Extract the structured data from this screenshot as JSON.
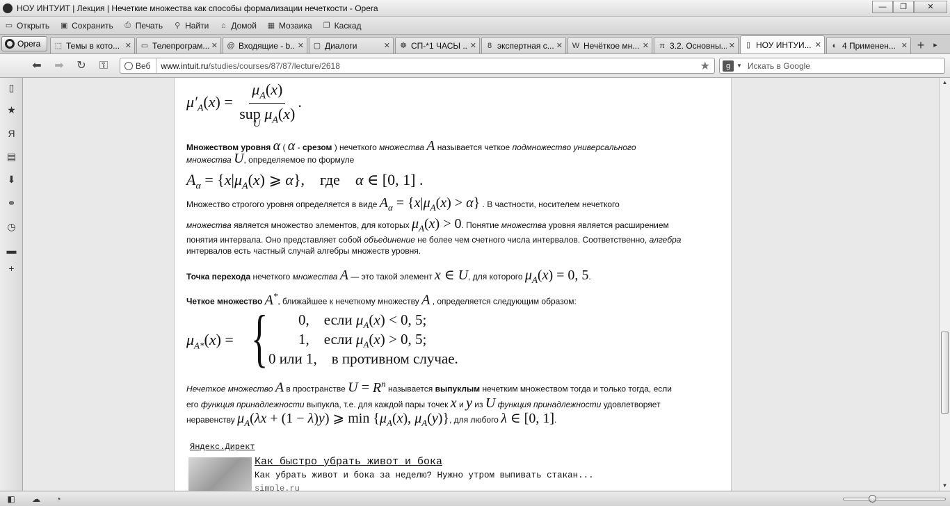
{
  "window": {
    "title": "НОУ ИНТУИТ | Лекция | Нечеткие множества как способы формализации нечеткости - Opera",
    "buttons": {
      "minimize": "—",
      "maximize": "❐",
      "close": "✕"
    }
  },
  "menubar": {
    "items": [
      {
        "label": "Открыть",
        "icon": "folder-icon"
      },
      {
        "label": "Сохранить",
        "icon": "save-icon"
      },
      {
        "label": "Печать",
        "icon": "print-icon"
      },
      {
        "label": "Найти",
        "icon": "search-icon"
      },
      {
        "label": "Домой",
        "icon": "home-icon"
      },
      {
        "label": "Мозаика",
        "icon": "tile-icon"
      },
      {
        "label": "Каскад",
        "icon": "cascade-icon"
      }
    ]
  },
  "tabbar": {
    "opera_label": "Opera",
    "tabs": [
      {
        "label": "Темы в кото...",
        "fav": "⬚",
        "active": false
      },
      {
        "label": "Телепрограм...",
        "fav": "▭",
        "active": false
      },
      {
        "label": "Входящие - b...",
        "fav": "@",
        "active": false
      },
      {
        "label": "Диалоги",
        "fav": "▢",
        "active": false
      },
      {
        "label": "СП-*1 ЧАСЫ ...",
        "fav": "☸",
        "active": false
      },
      {
        "label": "экспертная с...",
        "fav": "8",
        "active": false
      },
      {
        "label": "Нечёткое мн...",
        "fav": "W",
        "active": false
      },
      {
        "label": "3.2. Основны...",
        "fav": "π",
        "active": false
      },
      {
        "label": "НОУ ИНТУИ...",
        "fav": "▯",
        "active": true
      },
      {
        "label": "4 Применен...",
        "fav": "◐",
        "active": false
      }
    ],
    "new_tab": "+",
    "scroll": "▸"
  },
  "addressbar": {
    "web_label": "Веб",
    "url_host": "www.intuit.ru",
    "url_path": "/studies/courses/87/87/lecture/2618",
    "search_placeholder": "Искать в Google"
  },
  "content": {
    "p1_bold": "Множеством уровня",
    "p1_a": "(",
    "p1_b": "-",
    "p1_bold2": "срезом",
    "p1_c": ") нечеткого",
    "p1_i1": "множества",
    "p1_d": "называется четкое",
    "p1_i2": "подмножество универсального",
    "p1_i3": "множества",
    "p1_e": ", определяемое по формуле",
    "f2_where": "где",
    "p2_a": "Множество строгого уровня определяется в виде",
    "p2_b": ". В частности, носителем нечеткого",
    "p3_i1": "множества",
    "p3_a": "является множество элементов, для которых",
    "p3_b": ". Понятие",
    "p3_i2": "множества",
    "p3_c": "уровня является расширением",
    "p3_d": "понятия интервала. Оно представляет собой",
    "p3_i3": "объединение",
    "p3_e": "не более чем счетного числа интервалов. Соответственно,",
    "p3_i4": "алгебра",
    "p3_f": "интервалов есть частный случай алгебры множеств уровня.",
    "p4_bold": "Точка перехода",
    "p4_a": "нечеткого",
    "p4_i": "множества",
    "p4_b": "— это такой элемент",
    "p4_c": ", для которого",
    "p5_bold": "Четкое множество",
    "p5_a": ", ближайшее к нечеткому множеству",
    "p5_b": ", определяется следующим образом:",
    "case1_val": "0,",
    "case1_cond": "если",
    "case2_val": "1,",
    "case2_cond": "если",
    "case3_val": "0 или 1,",
    "case3_cond": "в противном случае.",
    "p6_i1": "Нечеткое множество",
    "p6_a": "в пространстве",
    "p6_b": "называется",
    "p6_bold": "выпуклым",
    "p6_c": "нечетким множеством тогда и только тогда, если",
    "p6_d": "его",
    "p6_i2": "функция принадлежности",
    "p6_e": "выпукла, т.е. для каждой пары точек",
    "p6_f": "и",
    "p6_g": "из",
    "p6_i3": "функция принадлежности",
    "p6_h": "удовлетворяет",
    "p6_j": "неравенству",
    "p6_k": ", для любого"
  },
  "ad": {
    "header": "Яндекс.Директ",
    "title": "Как быстро убрать живот и бока",
    "text": "Как убрать живот и бока за неделю? Нужно утром выпивать стакан...",
    "domain": "simple.ru"
  },
  "sidepanel": {
    "icons": [
      "remote-icon",
      "bookmarks-star-icon",
      "yandex-icon",
      "notes-icon",
      "downloads-icon",
      "links-icon",
      "history-icon",
      "panels-icon",
      "add-panel-icon"
    ]
  },
  "colors": {
    "page_bg": "#ffffff",
    "chrome_bg": "#e0e0e0",
    "text": "#111111"
  }
}
